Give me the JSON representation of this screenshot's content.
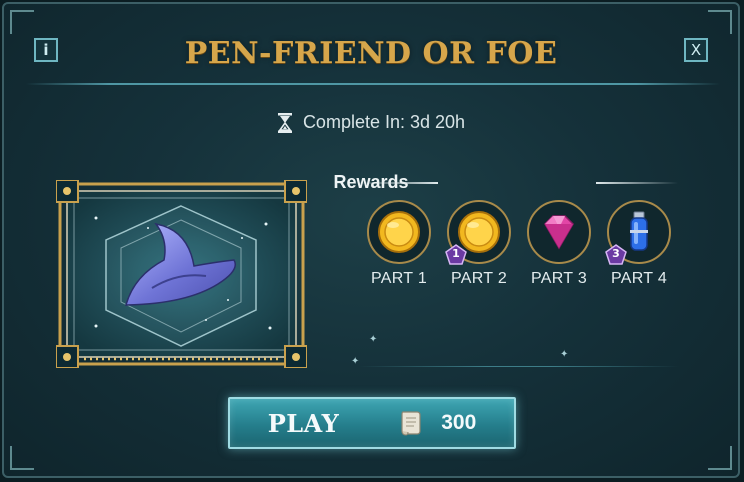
{
  "dialog": {
    "title": "PEN-FRIEND OR FOE",
    "info_label": "i",
    "close_label": "X"
  },
  "timer": {
    "icon": "hourglass-icon",
    "text": "Complete In: 3d 20h"
  },
  "featured": {
    "icon": "wizard-hat-icon"
  },
  "rewards": {
    "title": "Rewards",
    "parts": [
      {
        "label": "PART 1",
        "icon": "gold-coin-icon",
        "badge": ""
      },
      {
        "label": "PART 2",
        "icon": "gold-coin-icon",
        "badge": "1"
      },
      {
        "label": "PART 3",
        "icon": "pink-gem-icon",
        "badge": ""
      },
      {
        "label": "PART 4",
        "icon": "potion-vial-icon",
        "badge": "3"
      }
    ]
  },
  "play": {
    "label": "PLAY",
    "cost_icon": "scroll-icon",
    "cost": "300"
  },
  "colors": {
    "title_gold": "#d6a64b",
    "panel_teal": "#15313a",
    "button_teal": "#257e8c",
    "badge_purple": "#6b3aa3"
  }
}
